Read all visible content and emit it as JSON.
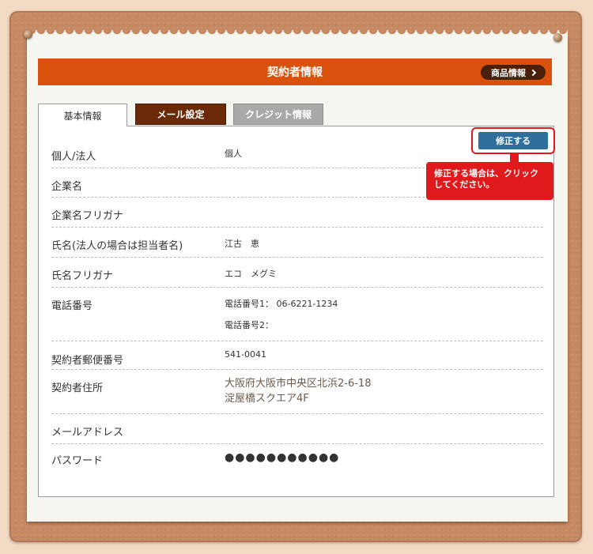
{
  "header": {
    "title": "契約者情報",
    "product_button": "商品情報"
  },
  "tabs": [
    {
      "label": "基本情報",
      "active": true
    },
    {
      "label": "メール設定",
      "active": false
    },
    {
      "label": "クレジット情報",
      "active": false
    }
  ],
  "edit": {
    "button": "修正する",
    "hint_line1": "修正する場合は、クリック",
    "hint_line2": "してください。"
  },
  "fields": {
    "type": {
      "label": "個人/法人",
      "value": "個人"
    },
    "company": {
      "label": "企業名",
      "value": ""
    },
    "company_kana": {
      "label": "企業名フリガナ",
      "value": ""
    },
    "name": {
      "label": "氏名(法人の場合は担当者名)",
      "value": "江古　恵"
    },
    "name_kana": {
      "label": "氏名フリガナ",
      "value": "エコ　メグミ"
    },
    "phone": {
      "label": "電話番号",
      "value1": "電話番号1： 06-6221-1234",
      "value2": "電話番号2："
    },
    "postal": {
      "label": "契約者郵便番号",
      "value": "541-0041"
    },
    "address": {
      "label": "契約者住所",
      "line1": "大阪府大阪市中央区北浜2-6-18",
      "line2": "淀屋橋スクエア4F"
    },
    "email": {
      "label": "メールアドレス",
      "value": ""
    },
    "password": {
      "label": "パスワード",
      "value": "●●●●●●●●●●●"
    }
  },
  "colors": {
    "accent": "#d9510c",
    "dark_brown": "#6b2a07",
    "edit_blue": "#2f6f9c",
    "callout_red": "#e0191c"
  }
}
